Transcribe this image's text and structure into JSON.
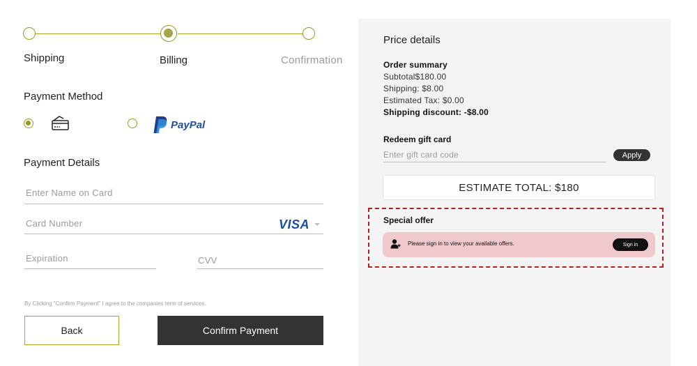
{
  "stepper": {
    "steps": [
      {
        "label": "Shipping",
        "state": "done"
      },
      {
        "label": "Billing",
        "state": "active"
      },
      {
        "label": "Confirmation",
        "state": "upcoming"
      }
    ]
  },
  "payment_method": {
    "title": "Payment Method",
    "options": [
      {
        "name": "card",
        "icon": "credit-card-icon",
        "selected": true
      },
      {
        "name": "paypal",
        "logo_text": "PayPal",
        "selected": false
      }
    ]
  },
  "payment_details": {
    "title": "Payment Details",
    "name_placeholder": "Enter Name on Card",
    "card_number_placeholder": "Card Number",
    "card_brand": "VISA",
    "expiration_placeholder": "Expiration",
    "cvv_placeholder": "CVV"
  },
  "terms_text": "By Clicking \"Confirm Payment\" I agree to the companies term of services.",
  "buttons": {
    "back": "Back",
    "confirm": "Confirm Payment"
  },
  "price_details": {
    "title": "Price details",
    "order_summary_label": "Order summary",
    "subtotal": "Subtotal$180.00",
    "shipping": "Shipping: $8.00",
    "tax": "Estimated Tax: $0.00",
    "shipping_discount": "Shipping discount: -$8.00",
    "gift_card_label": "Redeem gift card",
    "gift_card_placeholder": "Enter gift card code",
    "apply_label": "Apply",
    "estimate_total": "ESTIMATE TOTAL: $180"
  },
  "special_offer": {
    "title": "Special offer",
    "message": "Please sign in to view your available offers.",
    "sign_in_label": "Sign in"
  },
  "colors": {
    "accent": "#9a9a1e",
    "dark_button": "#333333",
    "offer_banner": "#f0c9cc",
    "offer_border": "#b32020",
    "visa_blue": "#1a4fa0",
    "paypal_blue": "#1d4fa3"
  }
}
